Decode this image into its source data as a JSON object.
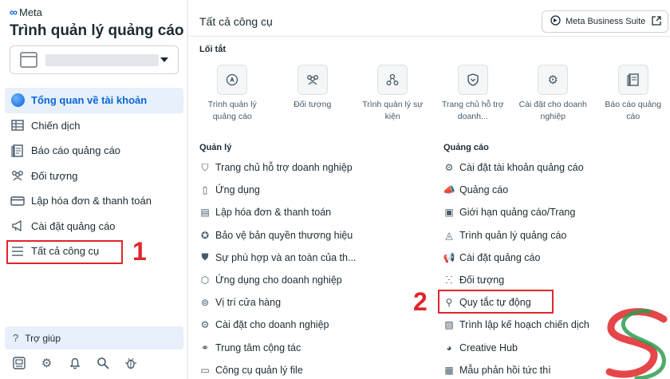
{
  "sidebar": {
    "brand": "Meta",
    "title": "Trình quản lý quảng cáo",
    "items": [
      {
        "label": "Tổng quan về tài khoản",
        "icon": "globe-icon",
        "active": true
      },
      {
        "label": "Chiến dịch",
        "icon": "table-icon"
      },
      {
        "label": "Báo cáo quảng cáo",
        "icon": "report-icon"
      },
      {
        "label": "Đối tượng",
        "icon": "people-icon"
      },
      {
        "label": "Lập hóa đơn & thanh toán",
        "icon": "billing-icon"
      },
      {
        "label": "Cài đặt quảng cáo",
        "icon": "megaphone-icon"
      },
      {
        "label": "Tất cả công cụ",
        "icon": "menu-icon"
      }
    ],
    "help": "Trợ giúp",
    "bottom_icons": [
      "dashboard-icon",
      "gear-icon",
      "bell-icon",
      "search-icon",
      "bug-icon"
    ]
  },
  "annotations": {
    "step1": "1",
    "step2": "2"
  },
  "main": {
    "title": "Tất cả công cụ",
    "business_suite": "Meta Business Suite",
    "shortcuts_heading": "Lối tắt",
    "shortcuts": [
      {
        "label": "Trình quản lý quảng cáo",
        "icon": "navigation-icon"
      },
      {
        "label": "Đối tượng",
        "icon": "people-icon"
      },
      {
        "label": "Trình quản lý sự kiện",
        "icon": "network-icon"
      },
      {
        "label": "Trang chủ hỗ trợ doanh...",
        "icon": "shield-icon"
      },
      {
        "label": "Cài đặt cho doanh nghiệp",
        "icon": "gear-icon"
      },
      {
        "label": "Báo cáo quảng cáo",
        "icon": "report-icon"
      }
    ],
    "manage_heading": "Quản lý",
    "manage": [
      {
        "label": "Trang chủ hỗ trợ doanh nghiệp",
        "icon": "shield-icon"
      },
      {
        "label": "Ứng dụng",
        "icon": "phone-icon"
      },
      {
        "label": "Lập hóa đơn & thanh toán",
        "icon": "invoice-icon"
      },
      {
        "label": "Bảo vệ bản quyền thương hiệu",
        "icon": "badge-check-icon"
      },
      {
        "label": "Sự phù hợp và an toàn của th...",
        "icon": "shield-check-icon"
      },
      {
        "label": "Ứng dụng cho doanh nghiệp",
        "icon": "cube-icon"
      },
      {
        "label": "Vị trí cửa hàng",
        "icon": "location-icon"
      },
      {
        "label": "Cài đặt cho doanh nghiệp",
        "icon": "gear-icon"
      },
      {
        "label": "Trung tâm cộng tác",
        "icon": "handshake-icon"
      },
      {
        "label": "Công cụ quản lý file",
        "icon": "folder-icon"
      }
    ],
    "ads_heading": "Quảng cáo",
    "ads": [
      {
        "label": "Cài đặt tài khoản quảng cáo",
        "icon": "settings-icon"
      },
      {
        "label": "Quảng cáo",
        "icon": "megaphone-icon"
      },
      {
        "label": "Giới hạn quảng cáo/Trang",
        "icon": "frame-icon"
      },
      {
        "label": "Trình quản lý quảng cáo",
        "icon": "navigation-icon"
      },
      {
        "label": "Cài đặt quảng cáo",
        "icon": "megaphone-icon"
      },
      {
        "label": "Đối tượng",
        "icon": "people-icon"
      },
      {
        "label": "Quy tắc tự động",
        "icon": "rules-icon"
      },
      {
        "label": "Trình lập kế hoạch chiến dịch",
        "icon": "calendar-icon"
      },
      {
        "label": "Creative Hub",
        "icon": "palette-icon"
      },
      {
        "label": "Mẫu phản hồi tức thì",
        "icon": "form-icon"
      }
    ]
  }
}
